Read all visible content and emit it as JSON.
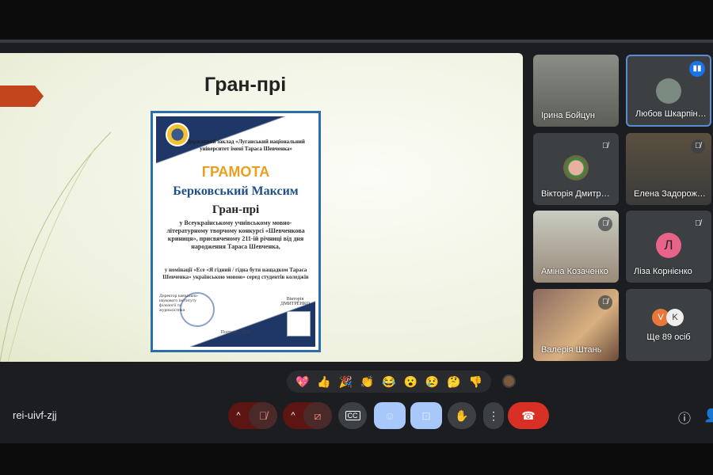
{
  "slide": {
    "title": "Гран-прі",
    "certificate": {
      "header": "Державний заклад «Луганський національний університет імені Тараса Шевченка»",
      "heading": "ГРАМОТА",
      "recipient": "Берковський Максим",
      "award": "Гран-прі",
      "body": "у Всеукраїнському учнівському мовно-літературному творчому конкурсі «Шевченкова криниця», присвяченому 211-ій річниці від дня народження Тараса Шевченка,",
      "nomination": "у номінації «Есе «Я гідний / гідна бути нащадком Тараса Шевченка» українською мовою» серед студентів коледжів",
      "director": "Директор навчально-наукового інституту філології та журналістики",
      "signatory": "Вікторія ДМИТРЕНКО",
      "city": "Полтава - 2025"
    }
  },
  "participants": [
    {
      "name": "Ірина Бойцун",
      "muted": false,
      "video": true
    },
    {
      "name": "Любов Шкарпін…",
      "speaking": true,
      "video": false
    },
    {
      "name": "Вікторія Дмитр…",
      "muted": true,
      "video": false
    },
    {
      "name": "Елена Задорож…",
      "muted": true,
      "video": true
    },
    {
      "name": "Аміна Козаченко",
      "muted": true,
      "video": true
    },
    {
      "name": "Ліза Корнієнко",
      "muted": true,
      "initial": "Л",
      "avatar_color": "#e8638a"
    },
    {
      "name": "Валерія Штань",
      "muted": true,
      "video": true
    },
    {
      "more": "Ще 89 осіб",
      "initials": [
        "V",
        "K"
      ]
    }
  ],
  "reactions": [
    "💖",
    "👍",
    "🎉",
    "👏",
    "😂",
    "😮",
    "😢",
    "🤔",
    "👎"
  ],
  "meeting_code": "rei-uivf-zjj",
  "controls": {
    "mic": "mic-off",
    "camera": "camera-off",
    "captions": "CC",
    "end_color": "#d93025"
  }
}
